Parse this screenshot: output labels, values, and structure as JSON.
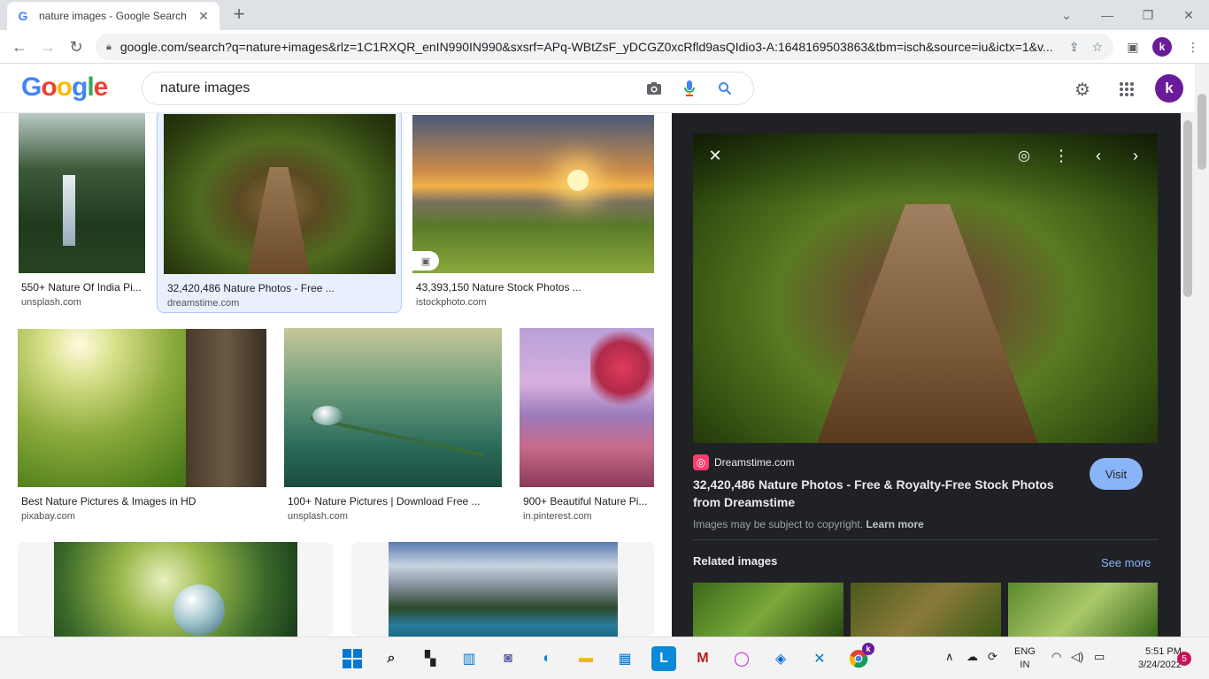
{
  "browser": {
    "tab_title": "nature images - Google Search",
    "tab_close": "✕",
    "new_tab": "+",
    "url": "google.com/search?q=nature+images&rlz=1C1RXQR_enIN990IN990&sxsrf=APq-WBtZsF_yDCGZ0xcRfld9asQIdio3-A:1648169503863&tbm=isch&source=iu&ictx=1&v...",
    "profile_initial": "k"
  },
  "header": {
    "logo_letters": [
      "G",
      "o",
      "o",
      "g",
      "l",
      "e"
    ],
    "query": "nature images",
    "profile_initial": "k"
  },
  "results": [
    {
      "title": "550+ Nature Of India Pi...",
      "source": "unsplash.com"
    },
    {
      "title": "32,420,486 Nature Photos - Free ...",
      "source": "dreamstime.com"
    },
    {
      "title": "43,393,150 Nature Stock Photos ...",
      "source": "istockphoto.com"
    },
    {
      "title": "Best Nature Pictures & Images in HD",
      "source": "pixabay.com"
    },
    {
      "title": "100+ Nature Pictures | Download Free ...",
      "source": "unsplash.com"
    },
    {
      "title": "900+ Beautiful Nature Pi...",
      "source": "in.pinterest.com"
    }
  ],
  "panel": {
    "source_name": "Dreamstime.com",
    "title": "32,420,486 Nature Photos - Free & Royalty-Free Stock Photos from Dreamstime",
    "visit_label": "Visit",
    "copyright_text": "Images may be subject to copyright.",
    "learn_more": "Learn more",
    "related_heading": "Related images",
    "see_more": "See more"
  },
  "taskbar": {
    "lang_line1": "ENG",
    "lang_line2": "IN",
    "time": "5:51 PM",
    "date": "3/24/2022",
    "notification_count": "5",
    "chrome_profile_badge": "k"
  },
  "colors": {
    "accent_blue": "#8ab4f8",
    "panel_bg": "#202124",
    "selected_card": "#e8f0fe",
    "avatar": "#6a1b9a"
  },
  "icons": [
    "back-icon",
    "forward-icon",
    "reload-icon",
    "lock-icon",
    "share-icon",
    "star-icon",
    "sidepanel-icon",
    "camera-icon",
    "mic-icon",
    "search-icon",
    "gear-icon",
    "apps-grid-icon",
    "close-icon",
    "lens-icon",
    "more-vert-icon",
    "chevron-left-icon",
    "chevron-right-icon"
  ]
}
